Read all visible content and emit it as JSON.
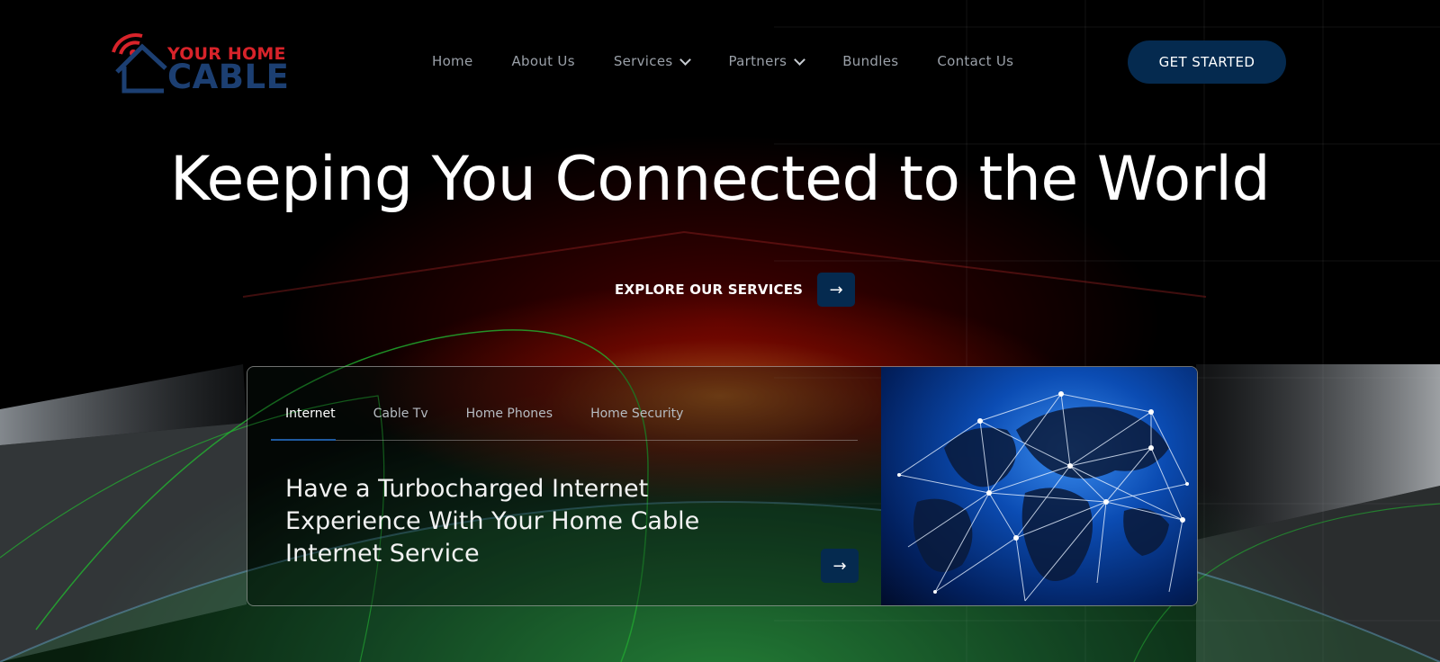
{
  "header": {
    "logo": {
      "line1": "YOUR HOME",
      "line2": "CABLE",
      "colors": {
        "red": "#d8232a",
        "blue": "#1c3f72"
      }
    },
    "nav": [
      {
        "label": "Home",
        "has_dropdown": false
      },
      {
        "label": "About Us",
        "has_dropdown": false
      },
      {
        "label": "Services",
        "has_dropdown": true
      },
      {
        "label": "Partners",
        "has_dropdown": true
      },
      {
        "label": "Bundles",
        "has_dropdown": false
      },
      {
        "label": "Contact Us",
        "has_dropdown": false
      }
    ],
    "cta_label": "GET STARTED"
  },
  "hero": {
    "title": "Keeping You Connected to the World",
    "explore_label": "EXPLORE OUR SERVICES",
    "arrow_icon": "arrow-right-icon"
  },
  "card": {
    "tabs": [
      {
        "label": "Internet",
        "active": true
      },
      {
        "label": "Cable Tv",
        "active": false
      },
      {
        "label": "Home Phones",
        "active": false
      },
      {
        "label": "Home Security",
        "active": false
      }
    ],
    "headline": "Have a Turbocharged Internet Experience With Your Home Cable Internet Service",
    "image": "network-globe"
  },
  "colors": {
    "accent": "#052a4f",
    "background": "#000000",
    "text": "#ffffff"
  }
}
